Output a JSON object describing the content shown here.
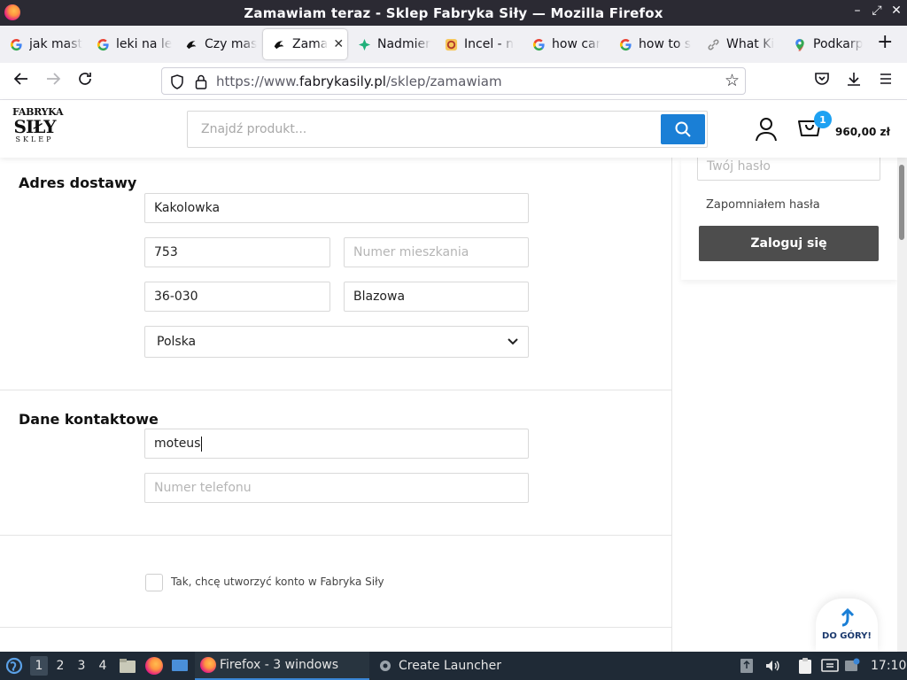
{
  "window": {
    "title": "Zamawiam teraz - Sklep Fabryka Siły — Mozilla Firefox",
    "controls": [
      "–",
      "⤢",
      "✕"
    ]
  },
  "tabs": [
    {
      "icon": "google-icon",
      "label": "jak mast"
    },
    {
      "icon": "google-icon",
      "label": "leki na le"
    },
    {
      "icon": "fabryka-icon",
      "label": "Czy mas"
    },
    {
      "icon": "fabryka-icon",
      "label": "Zama",
      "active": true
    },
    {
      "icon": "leaf-icon",
      "label": "Nadmier"
    },
    {
      "icon": "wiki-icon",
      "label": "Incel - n"
    },
    {
      "icon": "google-icon",
      "label": "how car"
    },
    {
      "icon": "google-icon",
      "label": "how to s"
    },
    {
      "icon": "link-icon",
      "label": "What Ki"
    },
    {
      "icon": "maps-icon",
      "label": "Podkarp"
    }
  ],
  "nav": {
    "url_prefix": "https://www.",
    "url_domain": "fabrykasily.pl",
    "url_path": "/sklep/zamawiam"
  },
  "site": {
    "logo_top": "FABRYKA",
    "logo_mid": "SIŁY",
    "logo_bottom": "SKLEP",
    "search_placeholder": "Znajdź produkt...",
    "cart_count": "1",
    "cart_total": "960,00 zł"
  },
  "delivery": {
    "title": "Adres dostawy",
    "street": "Kakolowka",
    "house_number": "753",
    "apartment_placeholder": "Numer mieszkania",
    "postal_code": "36-030",
    "city": "Blazowa",
    "country": "Polska"
  },
  "contact": {
    "title": "Dane kontaktowe",
    "email_value": "moteus",
    "phone_placeholder": "Numer telefonu"
  },
  "account": {
    "checkbox_label": "Tak, chcę utworzyć konto w Fabryka Siły",
    "checked": false
  },
  "login": {
    "password_placeholder": "Twój hasło",
    "forgot": "Zapomniałem hasła",
    "button": "Zaloguj się"
  },
  "to_top": "DO GÓRY!",
  "taskbar": {
    "workspaces": [
      "1",
      "2",
      "3",
      "4"
    ],
    "active_workspace": "1",
    "firefox_task": "Firefox - 3 windows",
    "launcher": "Create Launcher",
    "clock": "17:10"
  },
  "colors": {
    "accent": "#1a7fd6",
    "badge": "#1da1f2",
    "login_button": "#4d4d4d",
    "taskbar": "#1f2a36"
  }
}
